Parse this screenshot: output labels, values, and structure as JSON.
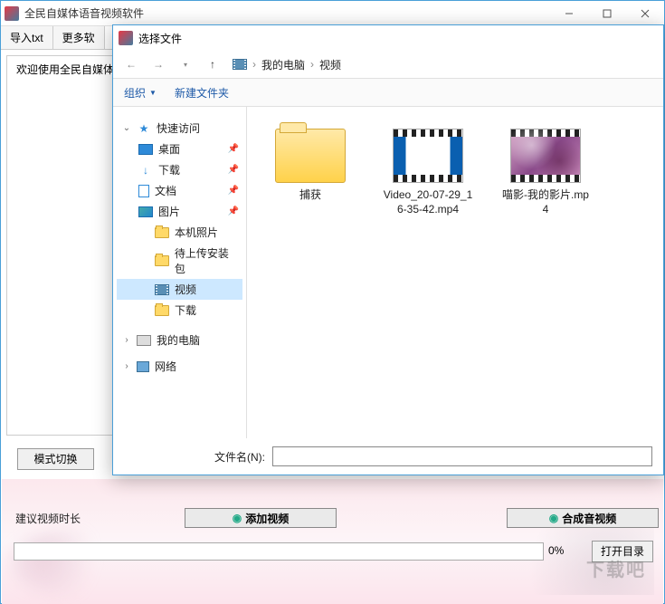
{
  "main": {
    "title": "全民自媒体语音视频软件",
    "toolbar": {
      "import_txt": "导入txt",
      "more_soft": "更多软"
    },
    "welcome": "欢迎使用全民自媒体",
    "mode_switch": "模式切换",
    "suggest_duration": "建议视频时长",
    "add_video": "添加视频",
    "compose_av": "合成音视频",
    "progress_pct": "0%",
    "open_dir": "打开目录",
    "watermark": "下载吧"
  },
  "dialog": {
    "title": "选择文件",
    "breadcrumb": {
      "root": "我的电脑",
      "sub": "视频"
    },
    "tools": {
      "organize": "组织",
      "new_folder": "新建文件夹"
    },
    "tree": {
      "quick_access": "快速访问",
      "desktop": "桌面",
      "downloads": "下载",
      "documents": "文档",
      "pictures": "图片",
      "local_photos": "本机照片",
      "pending_pkg": "待上传安装包",
      "video": "视频",
      "downloads2": "下载",
      "my_pc": "我的电脑",
      "network": "网络"
    },
    "files": {
      "f1": "捕获",
      "f2": "Video_20-07-29_16-35-42.mp4",
      "f3": "喵影-我的影片.mp4"
    },
    "filename_label": "文件名(N):"
  }
}
